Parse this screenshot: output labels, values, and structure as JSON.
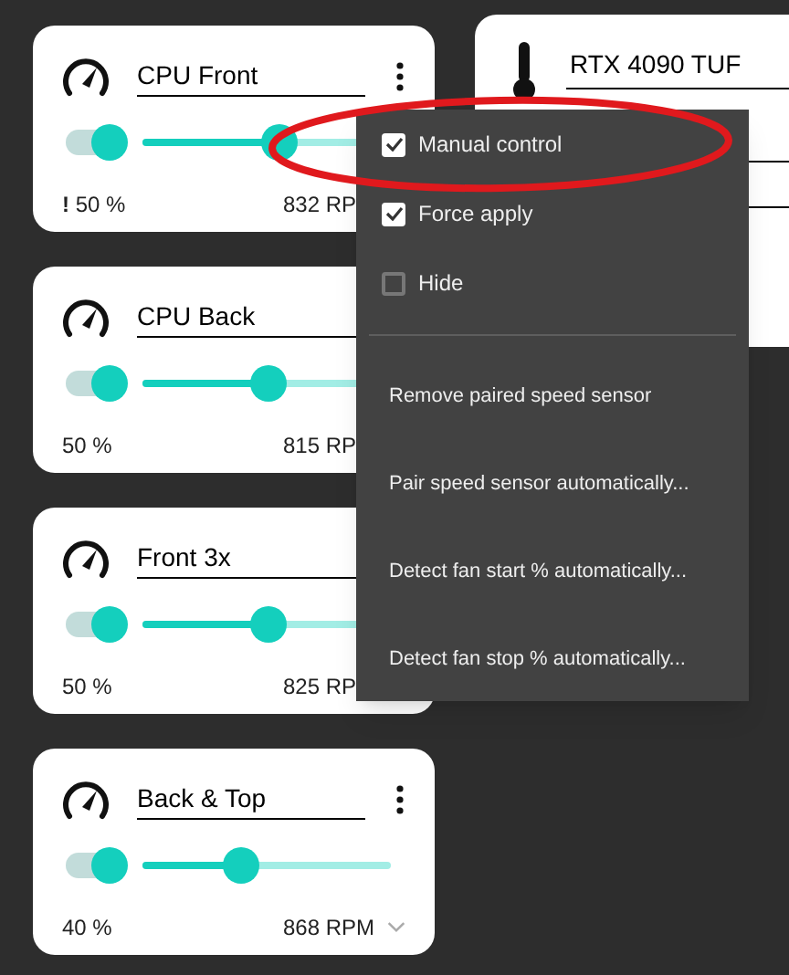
{
  "fans": [
    {
      "name": "CPU Front",
      "enabled": true,
      "level": 0.55,
      "percent": "**!** 50 %",
      "rpm": "832 RP",
      "chevron": false
    },
    {
      "name": "CPU Back",
      "enabled": true,
      "level": 0.51,
      "percent": "50 %",
      "rpm": "815 RP",
      "chevron": false
    },
    {
      "name": "Front 3x",
      "enabled": true,
      "level": 0.51,
      "percent": "50 %",
      "rpm": "825 RP",
      "chevron": false
    },
    {
      "name": "Back & Top",
      "enabled": true,
      "level": 0.4,
      "percent": "40 %",
      "rpm": "868 RPM",
      "chevron": true
    }
  ],
  "sensor_card": {
    "name": "RTX 4090 TUF"
  },
  "menu": {
    "items": [
      {
        "kind": "check",
        "label": "Manual control",
        "checked": true,
        "highlighted": true
      },
      {
        "kind": "check",
        "label": "Force apply",
        "checked": true,
        "highlighted": false
      },
      {
        "kind": "check",
        "label": "Hide",
        "checked": false,
        "highlighted": false
      },
      {
        "kind": "divider"
      },
      {
        "kind": "action",
        "label": "Remove paired speed sensor"
      },
      {
        "kind": "action",
        "label": "Pair speed sensor automatically..."
      },
      {
        "kind": "action",
        "label": "Detect fan start % automatically..."
      },
      {
        "kind": "action",
        "label": "Detect fan stop % automatically..."
      }
    ]
  }
}
